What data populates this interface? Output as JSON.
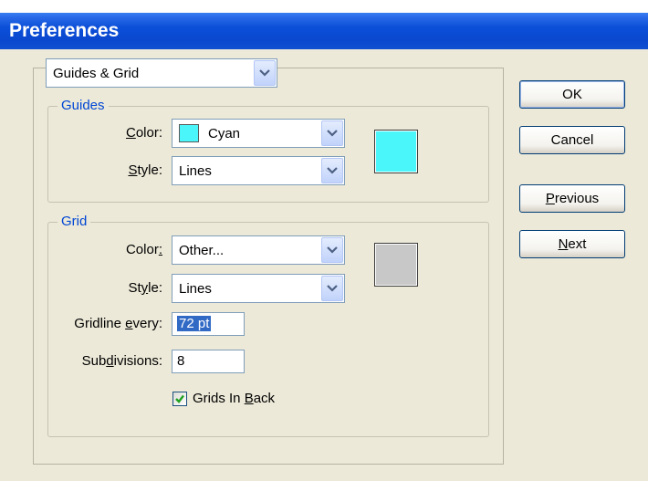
{
  "window": {
    "title": "Preferences"
  },
  "panel_select": {
    "value": "Guides & Grid"
  },
  "guides": {
    "title": "Guides",
    "color_label_mn": "C",
    "color_label_rest": "olor:",
    "color_value": "Cyan",
    "color_hex": "#4bf6fa",
    "style_label_mn": "S",
    "style_label_rest": "tyle:",
    "style_value": "Lines"
  },
  "grid": {
    "title": "Grid",
    "color_label_pre": "Color",
    "color_label_mn": ":",
    "color_value": "Other...",
    "color_hex": "#c8c8c8",
    "style_label_pre": "St",
    "style_label_mn": "y",
    "style_label_post": "le:",
    "style_value": "Lines",
    "gridline_label_pre": "Gridline ",
    "gridline_label_mn": "e",
    "gridline_label_post": "very:",
    "gridline_value": "72 pt",
    "subdiv_label_pre": "Sub",
    "subdiv_label_mn": "d",
    "subdiv_label_post": "ivisions:",
    "subdiv_value": "8",
    "back_label_pre": "Grids In ",
    "back_label_mn": "B",
    "back_label_post": "ack",
    "back_checked": true
  },
  "buttons": {
    "ok": "OK",
    "cancel": "Cancel",
    "previous_mn": "P",
    "previous_rest": "revious",
    "next_mn": "N",
    "next_rest": "ext"
  }
}
